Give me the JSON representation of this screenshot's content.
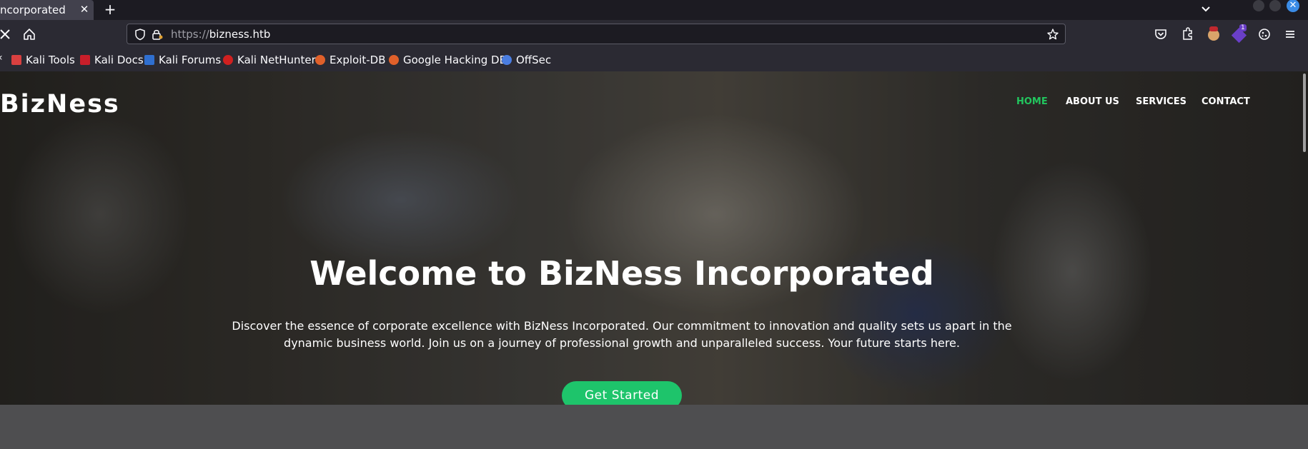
{
  "browser": {
    "tab_title": "ncorporated",
    "url_scheme": "https://",
    "url_host": "bizness.htb",
    "bookmarks": [
      "Kali Tools",
      "Kali Docs",
      "Kali Forums",
      "Kali NetHunter",
      "Exploit-DB",
      "Google Hacking DB",
      "OffSec"
    ],
    "extension_badge": "1"
  },
  "site": {
    "brand": "BizNess",
    "nav": [
      "HOME",
      "ABOUT US",
      "SERVICES",
      "CONTACT"
    ],
    "nav_active_color": "#22c55e",
    "hero_title": "Welcome to BizNess Incorporated",
    "hero_text": "Discover the essence of corporate excellence with BizNess Incorporated. Our commitment to innovation and quality sets us apart in the dynamic business world. Join us on a journey of professional growth and unparalleled success. Your future starts here.",
    "cta_label": "Get Started",
    "cta_color": "#1ec46b"
  }
}
